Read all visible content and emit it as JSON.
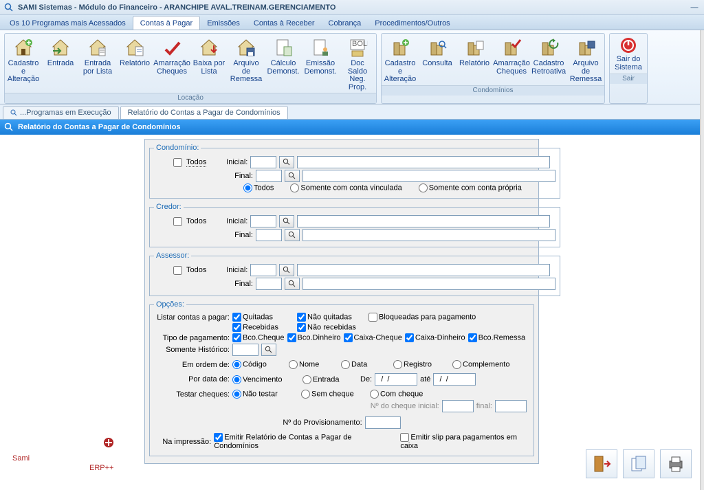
{
  "title": "SAMI Sistemas - Módulo do Financeiro - ARANCHIPE AVAL.TREINAM.GERENCIAMENTO",
  "menu": {
    "items": [
      "Os 10 Programas mais Acessados",
      "Contas à Pagar",
      "Emissões",
      "Contas à Receber",
      "Cobrança",
      "Procedimentos/Outros"
    ],
    "active": 1
  },
  "ribbon": {
    "groups": [
      {
        "label": "Locação",
        "items": [
          {
            "label": "Cadastro e Alteração"
          },
          {
            "label": "Entrada"
          },
          {
            "label": "Entrada por Lista"
          },
          {
            "label": "Relatório"
          },
          {
            "label": "Amarração Cheques"
          },
          {
            "label": "Baixa por Lista"
          },
          {
            "label": "Arquivo de Remessa"
          },
          {
            "label": "Cálculo Demonst."
          },
          {
            "label": "Emissão Demonst."
          },
          {
            "label": "Doc Saldo Neg. Prop."
          }
        ]
      },
      {
        "label": "Condomínios",
        "items": [
          {
            "label": "Cadastro e Alteração"
          },
          {
            "label": "Consulta"
          },
          {
            "label": "Relatório"
          },
          {
            "label": "Amarração Cheques"
          },
          {
            "label": "Cadastro Retroativa"
          },
          {
            "label": "Arquivo de Remessa"
          }
        ]
      },
      {
        "label": "Sair",
        "items": [
          {
            "label": "Sair do Sistema"
          }
        ]
      }
    ]
  },
  "subtabs": {
    "items": [
      "...Programas em Execução",
      "Relatório do Contas a Pagar de Condomínios"
    ],
    "active": 1
  },
  "page_title": "Relatório do Contas a Pagar de Condomínios",
  "form": {
    "condominio": {
      "legend": "Condomínio:",
      "todos_label": "Todos",
      "inicial": "Inicial:",
      "final": "Final:",
      "radios": [
        "Todos",
        "Somente com conta vinculada",
        "Somente com conta própria"
      ]
    },
    "credor": {
      "legend": "Credor:",
      "todos_label": "Todos",
      "inicial": "Inicial:",
      "final": "Final:"
    },
    "assessor": {
      "legend": "Assessor:",
      "todos_label": "Todos",
      "inicial": "Inicial:",
      "final": "Final:"
    },
    "opcoes": {
      "legend": "Opções:",
      "listar_lbl": "Listar contas a pagar:",
      "check": {
        "quitadas": "Quitadas",
        "nao_quitadas": "Não quitadas",
        "bloqueadas": "Bloqueadas para pagamento",
        "recebidas": "Recebidas",
        "nao_recebidas": "Não recebidas"
      },
      "tipo_lbl": "Tipo de pagamento:",
      "tipos": [
        "Bco.Cheque",
        "Bco.Dinheiro",
        "Caixa-Cheque",
        "Caixa-Dinheiro",
        "Bco.Remessa"
      ],
      "som_hist": "Somente Histórico:",
      "ordem_lbl": "Em ordem de:",
      "ordem": [
        "Código",
        "Nome",
        "Data",
        "Registro",
        "Complemento"
      ],
      "por_data_lbl": "Por data de:",
      "por_data": [
        "Vencimento",
        "Entrada"
      ],
      "de": "De:",
      "ate": "até",
      "de_val": "  /  /",
      "ate_val": "  /  /",
      "testar_lbl": "Testar cheques:",
      "testar": [
        "Não testar",
        "Sem cheque",
        "Com cheque"
      ],
      "cheque_ini": "Nº do cheque inicial:",
      "cheque_fim": "final:",
      "prov": "Nº do Provisionamento:",
      "imp_lbl": "Na impressão:",
      "imp_rel": "Emitir Relatório de Contas a Pagar de Condomínios",
      "imp_slip": "Emitir slip para pagamentos em caixa"
    }
  },
  "logo": {
    "text": "Sami",
    "sub": "ERP++"
  }
}
